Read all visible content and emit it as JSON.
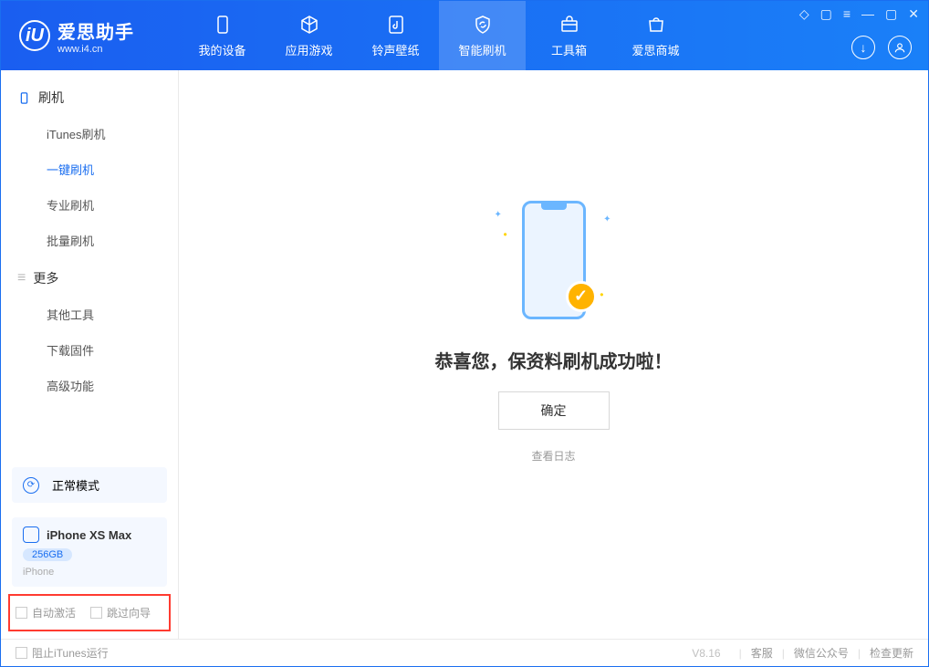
{
  "app": {
    "logo_initial": "iU",
    "title": "爱思助手",
    "subtitle": "www.i4.cn"
  },
  "nav": {
    "items": [
      {
        "label": "我的设备"
      },
      {
        "label": "应用游戏"
      },
      {
        "label": "铃声壁纸"
      },
      {
        "label": "智能刷机"
      },
      {
        "label": "工具箱"
      },
      {
        "label": "爱思商城"
      }
    ]
  },
  "sidebar": {
    "group1_title": "刷机",
    "group1_items": [
      {
        "label": "iTunes刷机"
      },
      {
        "label": "一键刷机"
      },
      {
        "label": "专业刷机"
      },
      {
        "label": "批量刷机"
      }
    ],
    "group2_title": "更多",
    "group2_items": [
      {
        "label": "其他工具"
      },
      {
        "label": "下载固件"
      },
      {
        "label": "高级功能"
      }
    ],
    "mode_label": "正常模式",
    "device_name": "iPhone XS Max",
    "device_storage": "256GB",
    "device_type": "iPhone",
    "auto_activate_label": "自动激活",
    "skip_guide_label": "跳过向导"
  },
  "main": {
    "success_text": "恭喜您，保资料刷机成功啦！",
    "ok_button": "确定",
    "log_link": "查看日志"
  },
  "footer": {
    "stop_itunes_label": "阻止iTunes运行",
    "version": "V8.16",
    "links": [
      {
        "label": "客服"
      },
      {
        "label": "微信公众号"
      },
      {
        "label": "检查更新"
      }
    ]
  }
}
